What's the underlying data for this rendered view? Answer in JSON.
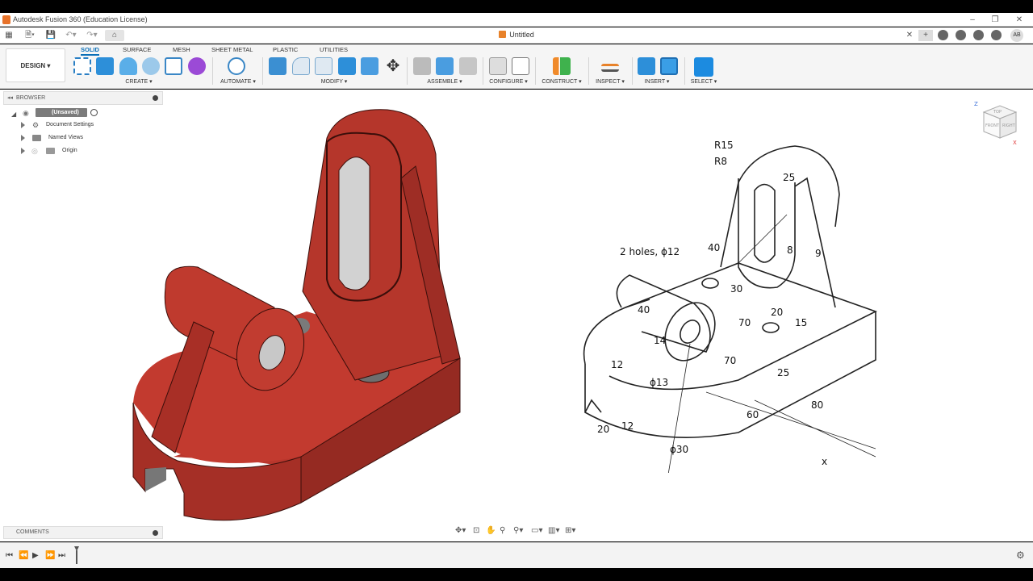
{
  "titlebar": {
    "title": "Autodesk Fusion 360 (Education License)"
  },
  "tabbar": {
    "doc_title": "Untitled",
    "user_initials": "AB"
  },
  "ribbon": {
    "workspace": "DESIGN ▾",
    "tabs": [
      "SOLID",
      "SURFACE",
      "MESH",
      "SHEET METAL",
      "PLASTIC",
      "UTILITIES"
    ],
    "active_tab": "SOLID",
    "groups": [
      "CREATE ▾",
      "AUTOMATE ▾",
      "MODIFY ▾",
      "ASSEMBLE ▾",
      "CONFIGURE ▾",
      "CONSTRUCT ▾",
      "INSPECT ▾",
      "INSERT ▾",
      "SELECT ▾"
    ]
  },
  "browser": {
    "title": "BROWSER",
    "root": "(Unsaved)",
    "items": [
      "Document Settings",
      "Named Views",
      "Origin"
    ]
  },
  "comments": {
    "title": "COMMENTS"
  },
  "viewcube": {
    "labels": [
      "TOP",
      "FRONT",
      "RIGHT"
    ],
    "axes": [
      "Z",
      "X"
    ]
  },
  "drawing": {
    "labels": [
      "R15",
      "R8",
      "25",
      "40",
      "2 holes, ϕ12",
      "8",
      "9",
      "30",
      "40",
      "20",
      "70",
      "15",
      "14",
      "70",
      "12",
      "ϕ13",
      "25",
      "60",
      "80",
      "20",
      "12",
      "ϕ30",
      "x"
    ]
  },
  "colors": {
    "model": "#b8362c",
    "accent": "#0a6fb8"
  }
}
